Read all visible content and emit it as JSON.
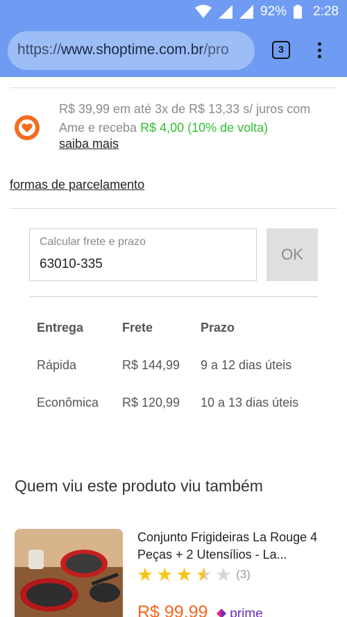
{
  "status_bar": {
    "battery": "92%",
    "time": "2:28",
    "icons": [
      "wifi-icon",
      "signal-icon",
      "signal-icon",
      "battery-icon"
    ]
  },
  "browser": {
    "url_scheme": "https://",
    "url_host": "www.shoptime.com.br",
    "url_rest": "/pro",
    "tab_count": "3",
    "chrome_color": "#6f9cf2"
  },
  "payment": {
    "installment_text": "R$ 39,99 em até 3x de R$ 13,33 s/ juros com",
    "ame_prefix": "Ame e receba ",
    "cashback": "R$ 4,00 (10% de volta)",
    "learn_more": "saiba mais",
    "installment_link": "formas de parcelamento"
  },
  "shipping": {
    "label": "Calcular frete e prazo",
    "zip": "63010-335",
    "ok": "OK",
    "headers": [
      "Entrega",
      "Frete",
      "Prazo"
    ],
    "rows": [
      [
        "Rápida",
        "R$ 144,99",
        "9 a 12 dias úteis"
      ],
      [
        "Econômica",
        "R$ 120,99",
        "10 a 13 dias úteis"
      ]
    ]
  },
  "recommendations": {
    "title": "Quem viu este produto viu também",
    "items": [
      {
        "name": "Conjunto Frigideiras La Rouge 4 Peças + 2 Utensílios - La...",
        "rating": 3.5,
        "reviews": "(3)",
        "price": "R$ 99,99",
        "badge": "prime"
      }
    ]
  },
  "colors": {
    "ame_orange": "#f56b1f",
    "cashback_green": "#2fc12f",
    "price_orange": "#f5671f",
    "prime_purple": "#6c2bbd",
    "star": "#f5c518"
  }
}
